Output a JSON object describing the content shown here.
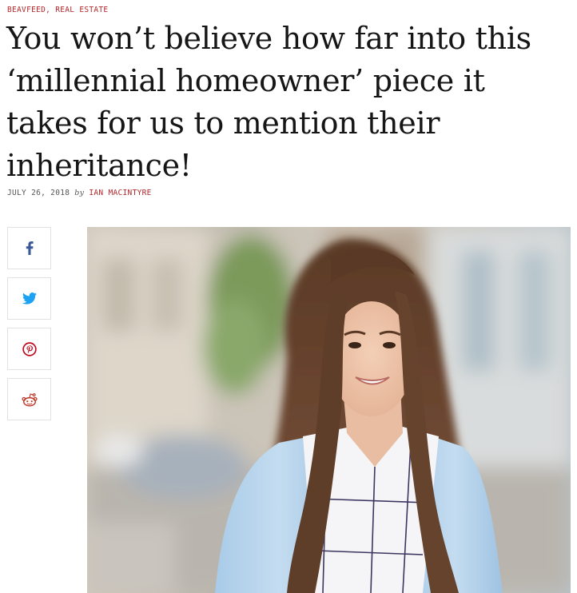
{
  "article": {
    "categories": [
      "BEAVFEED",
      "REAL ESTATE"
    ],
    "category_separator": ",",
    "title": "You won’t believe how far into this ‘millennial homeowner’ piece it takes for us to mention their inheritance!",
    "date": "JULY 26, 2018",
    "by_label": "by",
    "author": "IAN MACINTYRE"
  },
  "share_buttons": [
    {
      "icon": "facebook-icon",
      "color": "#3b5998"
    },
    {
      "icon": "twitter-icon",
      "color": "#1da1f2"
    },
    {
      "icon": "pinterest-icon",
      "color": "#bd081c"
    },
    {
      "icon": "reddit-icon",
      "color": "#c0392b"
    }
  ],
  "colors": {
    "accent": "#b3262b",
    "text": "#161616",
    "border": "#e2e2e2"
  }
}
